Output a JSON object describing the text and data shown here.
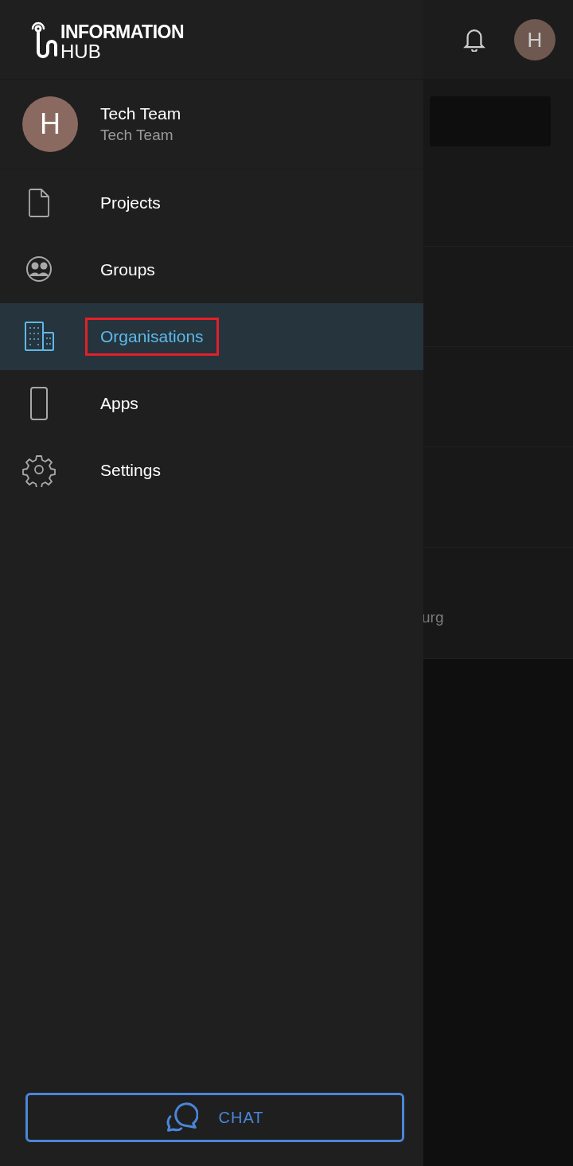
{
  "app_header": {
    "avatar_initial": "H"
  },
  "background_list": {
    "partial_text": "urg"
  },
  "drawer": {
    "logo": {
      "line_1": "INFORMATION",
      "line_2": "HUB"
    },
    "profile": {
      "initial": "H",
      "name": "Tech Team",
      "subtitle": "Tech Team"
    },
    "menu": [
      {
        "kind": "file",
        "label": "Projects",
        "selected": false,
        "highlighted": false
      },
      {
        "kind": "group",
        "label": "Groups",
        "selected": false,
        "highlighted": false
      },
      {
        "kind": "building",
        "label": "Organisations",
        "selected": true,
        "highlighted": true
      },
      {
        "kind": "phone",
        "label": "Apps",
        "selected": false,
        "highlighted": false
      },
      {
        "kind": "gear",
        "label": "Settings",
        "selected": false,
        "highlighted": false
      }
    ],
    "chat_button": {
      "label": "CHAT"
    }
  }
}
